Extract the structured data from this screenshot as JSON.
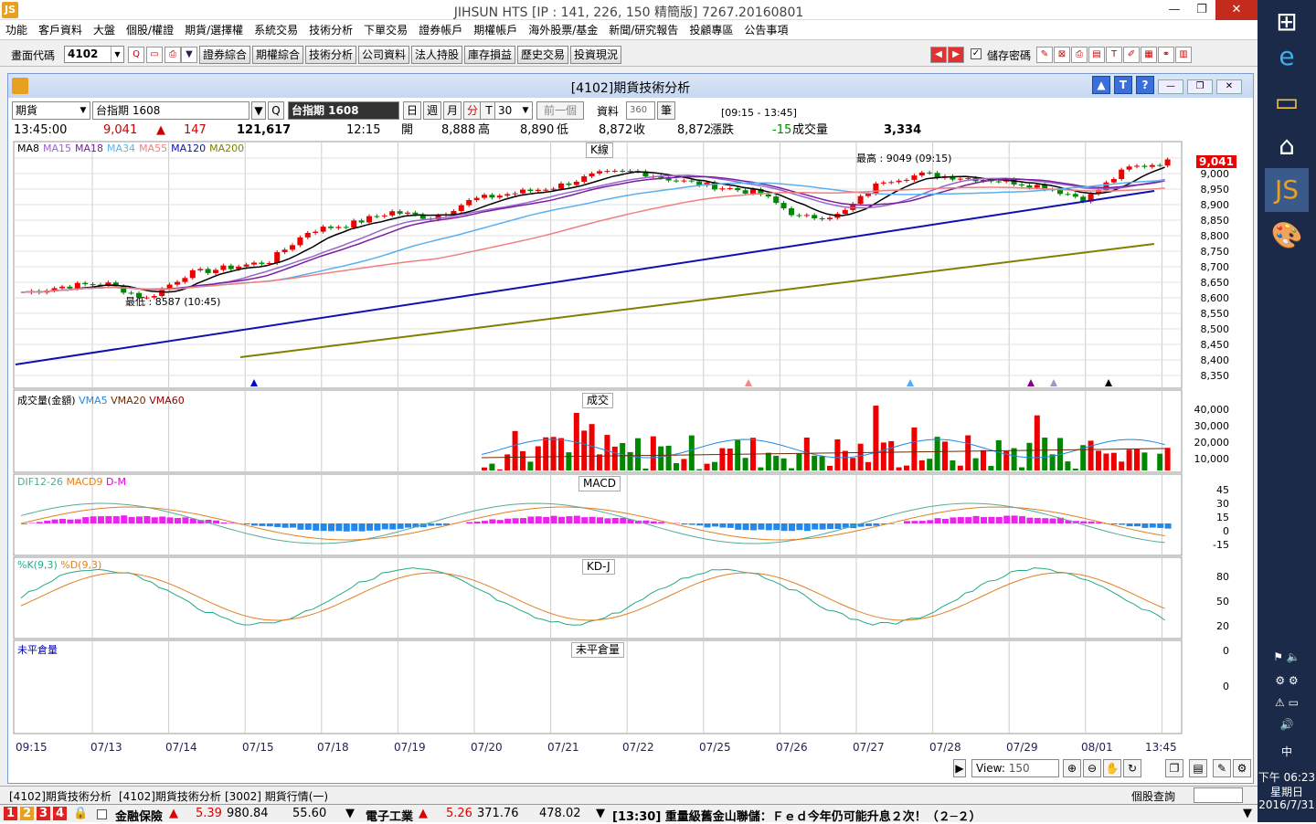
{
  "window": {
    "title": "JIHSUN HTS    [IP : 141, 226, 150 精簡版] 7267.20160801"
  },
  "menu": [
    "功能",
    "客戶資料",
    "大盤",
    "個股/權證",
    "期貨/選擇權",
    "系統交易",
    "技術分析",
    "下單交易",
    "證券帳戶",
    "期權帳戶",
    "海外股票/基金",
    "新聞/研究報告",
    "投顧專區",
    "公告事項"
  ],
  "toolbar": {
    "code_label": "畫面代碼",
    "code_value": "4102",
    "buttons": [
      "證券綜合",
      "期權綜合",
      "技術分析",
      "公司資料",
      "法人持股",
      "庫存損益",
      "歷史交易",
      "投資現況"
    ],
    "save_pw": "儲存密碼"
  },
  "panel": {
    "title": "[4102]期貨技術分析",
    "type": "期貨",
    "symbol": "台指期 1608",
    "symbol_dark": "台指期 1608",
    "periods": [
      "日",
      "週",
      "月",
      "分",
      "T"
    ],
    "interval": "30",
    "prev": "前一個",
    "data_label": "資料",
    "data_value": "360",
    "unit": "筆",
    "time_range": "[09:15 - 13:45]"
  },
  "quote": {
    "time": "13:45:00",
    "price": "9,041",
    "change": "147",
    "volume": "121,617",
    "t2": "12:15",
    "open_l": "開",
    "open": "8,888",
    "high_l": "高",
    "high": "8,890",
    "low_l": "低",
    "low": "8,872",
    "close_l": "收",
    "close": "8,872",
    "chg_l": "漲跌",
    "chg": "-15",
    "vol_l": "成交量",
    "vol": "3,334"
  },
  "kline": {
    "label": "K線",
    "ma": [
      "MA8",
      "MA15",
      "MA18",
      "MA34",
      "MA55",
      "MA120",
      "MA200"
    ],
    "ma_colors": [
      "#000000",
      "#9966cc",
      "#7a1fa0",
      "#5ab0f0",
      "#f08080",
      "#1010b0",
      "#808000"
    ],
    "price_tag": "9,041",
    "high_note": "最高 : 9049 (09:15)",
    "low_note": "最低 : 8587 (10:45)",
    "axis": [
      "9,000",
      "8,950",
      "8,900",
      "8,850",
      "8,800",
      "8,750",
      "8,700",
      "8,650",
      "8,600",
      "8,550",
      "8,500",
      "8,450",
      "8,400",
      "8,350"
    ]
  },
  "volume": {
    "label": "成交",
    "legend": "成交量(金額)",
    "vma": [
      "VMA5",
      "VMA20",
      "VMA60"
    ],
    "axis": [
      "40,000",
      "30,000",
      "20,000",
      "10,000"
    ]
  },
  "macd": {
    "label": "MACD",
    "legend": [
      "DIF12-26",
      "MACD9",
      "D-M"
    ],
    "axis": [
      "45",
      "30",
      "15",
      "0",
      "-15"
    ]
  },
  "kd": {
    "label": "KD-J",
    "legend": [
      "%K(9,3)",
      "%D(9,3)"
    ],
    "axis": [
      "80",
      "50",
      "20",
      "0"
    ]
  },
  "oi": {
    "label": "未平倉量",
    "legend": "未平倉量",
    "axis": [
      "0"
    ]
  },
  "dates": [
    "09:15",
    "07/13",
    "07/14",
    "07/15",
    "07/18",
    "07/19",
    "07/20",
    "07/21",
    "07/22",
    "07/25",
    "07/26",
    "07/27",
    "07/28",
    "07/29",
    "08/01",
    "13:45"
  ],
  "view": {
    "label": "View:",
    "value": "150"
  },
  "tabs": [
    "[4102]期貨技術分析",
    "[4102]期貨技術分析",
    "[3002] 期貨行情(一)"
  ],
  "stock_query": "個股查詢",
  "ticker": {
    "pages": [
      "1",
      "2",
      "3",
      "4"
    ],
    "item1": "金融保險",
    "v1a": "5.39",
    "v1b": "980.84",
    "v1c": "55.60",
    "item2": "電子工業",
    "v2a": "5.26",
    "v2b": "371.76",
    "v2c": "478.02",
    "news": "[13:30] 重量級舊金山聯儲：Ｆｅｄ今年仍可能升息２次！（２─２）"
  },
  "clock": {
    "time": "下午 06:23",
    "day": "星期日",
    "date": "2016/7/31",
    "ime": "中"
  }
}
